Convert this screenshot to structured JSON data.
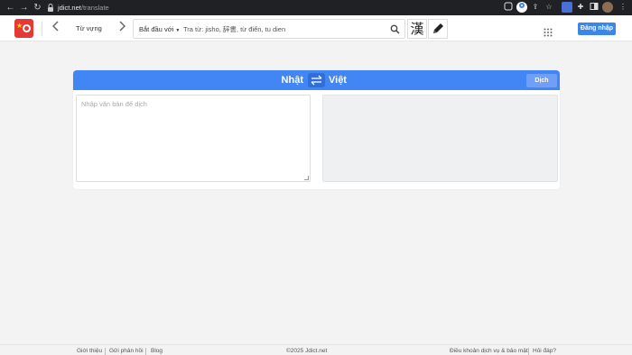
{
  "browser": {
    "url_host": "jdict.net",
    "url_path": "/translate"
  },
  "header": {
    "mode_label": "Từ vựng",
    "search_mode": "Bắt đầu với",
    "search_placeholder": "Tra từ: jisho, 辞書, từ điển, tu dien",
    "kanji_label": "漢",
    "login_label": "Đăng nhập"
  },
  "translator": {
    "source_lang": "Nhật",
    "target_lang": "Việt",
    "translate_label": "Dịch",
    "source_placeholder": "Nhập văn bản để dịch"
  },
  "footer": {
    "links": [
      "Giới thiệu",
      "Gửi phản hồi",
      "Blog"
    ],
    "copyright": "©2025 Jdict.net",
    "terms": "Điều khoản dịch vụ & bảo mật",
    "faq": "Hỏi đáp?"
  },
  "colors": {
    "brand_blue": "#4285f4",
    "login_blue": "#3a87e8",
    "logo_red": "#e53935"
  }
}
